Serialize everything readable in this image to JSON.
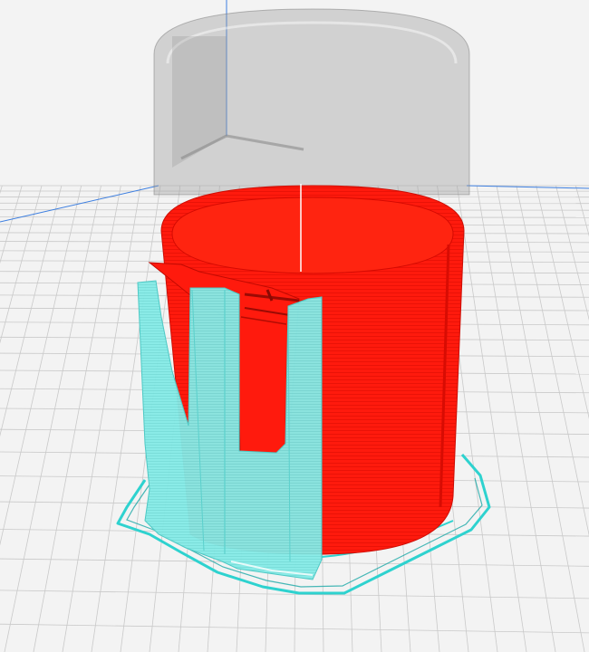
{
  "viewport": {
    "mode": "layer-view",
    "colors": {
      "background": "#f3f3f3",
      "build-plate-grid": "#c9c9c9",
      "build-volume": "#8f8f8f",
      "axis-x": "#3d7fe0",
      "axis-z": "#3d7fe0",
      "outer-wall": "#ff1a0d",
      "support": "#7fe8e4",
      "skirt": "#2ed2cf"
    },
    "objects": [
      {
        "name": "cylindrical-part",
        "feature": "outer-wall"
      },
      {
        "name": "support-structure",
        "feature": "support"
      },
      {
        "name": "skirt-outline",
        "feature": "skirt"
      }
    ]
  }
}
